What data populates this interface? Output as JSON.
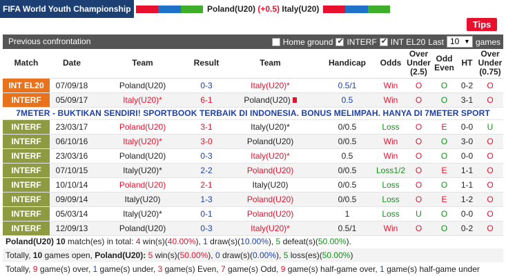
{
  "header": {
    "league": "FIFA World Youth Championship",
    "home": "Poland(U20)",
    "handicap": "(+0.5)",
    "away": "Italy(U20)",
    "home_colors": [
      "#e8112d",
      "#e8112d",
      "#1e73c8",
      "#1e73c8",
      "#3fae2a",
      "#3fae2a"
    ],
    "away_colors": [
      "#e8112d",
      "#e8112d",
      "#1e73c8",
      "#1e73c8",
      "#3fae2a",
      "#3fae2a"
    ]
  },
  "tips_label": "Tips",
  "filter": {
    "title": "Previous confrontation",
    "home_ground": "Home ground",
    "interf": "INTERF",
    "intel": "INT EL20",
    "last_label": "Last",
    "last_value": "10",
    "games_label": "games"
  },
  "columns": [
    "Match",
    "Date",
    "Team",
    "Result",
    "Team",
    "Handicap",
    "Odds",
    "Over Under (2.5)",
    "Odd Even",
    "HT",
    "Over Under (0.75)"
  ],
  "ad_text": "7METER - BUKTIKAN SENDIRI! SPORTBOOK TERBAIK DI INDONESIA. BONUS MELIMPAH. HANYA DI 7METER SPORT",
  "rows": [
    {
      "league": "INT EL20",
      "league_color": "#e8731c",
      "date": "07/09/18",
      "home": "Poland(U20)",
      "home_red": false,
      "home_card": false,
      "result": "0-3",
      "result_color": "blue",
      "away": "Italy(U20)*",
      "away_red": true,
      "handicap": "0.5/1",
      "hcp_color": "blue",
      "odds": "Win",
      "odds_color": "red",
      "ou": "O",
      "ou_color": "red",
      "oe": "O",
      "oe_color": "green",
      "ht": "0-2",
      "ou2": "O",
      "ou2_color": "red"
    },
    {
      "league": "INTERF",
      "league_color": "#e8731c",
      "date": "05/09/17",
      "home": "Italy(U20)*",
      "home_red": true,
      "home_card": false,
      "result": "6-1",
      "result_color": "red",
      "away": "Poland(U20)",
      "away_red": false,
      "away_card": true,
      "handicap": "0.5",
      "hcp_color": "blue",
      "odds": "Win",
      "odds_color": "red",
      "ou": "O",
      "ou_color": "red",
      "oe": "O",
      "oe_color": "green",
      "ht": "3-1",
      "ou2": "O",
      "ou2_color": "red"
    },
    {
      "league": "INTERF",
      "league_color": "#8f9b41",
      "date": "23/03/17",
      "home": "Poland(U20)",
      "home_red": true,
      "home_card": false,
      "result": "3-1",
      "result_color": "red",
      "away": "Italy(U20)*",
      "away_red": false,
      "handicap": "0/0.5",
      "hcp_color": "",
      "odds": "Loss",
      "odds_color": "green",
      "ou": "O",
      "ou_color": "red",
      "oe": "E",
      "oe_color": "red",
      "ht": "0-0",
      "ou2": "U",
      "ou2_color": "green"
    },
    {
      "league": "INTERF",
      "league_color": "#8f9b41",
      "date": "06/10/16",
      "home": "Italy(U20)*",
      "home_red": true,
      "home_card": false,
      "result": "3-0",
      "result_color": "red",
      "away": "Poland(U20)",
      "away_red": false,
      "handicap": "0/0.5",
      "hcp_color": "",
      "odds": "Win",
      "odds_color": "red",
      "ou": "O",
      "ou_color": "red",
      "oe": "O",
      "oe_color": "green",
      "ht": "3-0",
      "ou2": "O",
      "ou2_color": "red"
    },
    {
      "league": "INTERF",
      "league_color": "#8f9b41",
      "date": "23/03/16",
      "home": "Poland(U20)",
      "home_red": false,
      "home_card": false,
      "result": "0-3",
      "result_color": "blue",
      "away": "Italy(U20)*",
      "away_red": true,
      "handicap": "0.5",
      "hcp_color": "",
      "odds": "Win",
      "odds_color": "red",
      "ou": "O",
      "ou_color": "red",
      "oe": "O",
      "oe_color": "green",
      "ht": "0-0",
      "ou2": "O",
      "ou2_color": "red"
    },
    {
      "league": "INTERF",
      "league_color": "#8f9b41",
      "date": "07/10/15",
      "home": "Italy(U20)*",
      "home_red": false,
      "home_card": false,
      "result": "2-2",
      "result_color": "blue",
      "away": "Poland(U20)",
      "away_red": true,
      "handicap": "0/0.5",
      "hcp_color": "",
      "odds": "Loss1/2",
      "odds_color": "green",
      "ou": "O",
      "ou_color": "red",
      "oe": "E",
      "oe_color": "red",
      "ht": "1-1",
      "ou2": "O",
      "ou2_color": "red"
    },
    {
      "league": "INTERF",
      "league_color": "#8f9b41",
      "date": "10/10/14",
      "home": "Poland(U20)",
      "home_red": true,
      "home_card": false,
      "result": "2-1",
      "result_color": "red",
      "away": "Italy(U20)",
      "away_red": false,
      "handicap": "0/0.5",
      "hcp_color": "",
      "odds": "Loss",
      "odds_color": "green",
      "ou": "O",
      "ou_color": "red",
      "oe": "O",
      "oe_color": "green",
      "ht": "1-1",
      "ou2": "O",
      "ou2_color": "red"
    },
    {
      "league": "INTERF",
      "league_color": "#8f9b41",
      "date": "09/09/14",
      "home": "Italy(U20)",
      "home_red": false,
      "home_card": false,
      "result": "1-3",
      "result_color": "blue",
      "away": "Poland(U20)",
      "away_red": true,
      "handicap": "0/0.5",
      "hcp_color": "",
      "odds": "Loss",
      "odds_color": "green",
      "ou": "O",
      "ou_color": "red",
      "oe": "E",
      "oe_color": "red",
      "ht": "1-2",
      "ou2": "O",
      "ou2_color": "red"
    },
    {
      "league": "INTERF",
      "league_color": "#8f9b41",
      "date": "05/03/14",
      "home": "Italy(U20)*",
      "home_red": false,
      "home_card": false,
      "result": "0-1",
      "result_color": "blue",
      "away": "Poland(U20)",
      "away_red": true,
      "handicap": "1",
      "hcp_color": "",
      "odds": "Loss",
      "odds_color": "green",
      "ou": "U",
      "ou_color": "green",
      "oe": "O",
      "oe_color": "green",
      "ht": "0-0",
      "ou2": "O",
      "ou2_color": "red"
    },
    {
      "league": "INTERF",
      "league_color": "#8f9b41",
      "date": "12/09/13",
      "home": "Poland(U20)",
      "home_red": false,
      "home_card": false,
      "result": "0-3",
      "result_color": "blue",
      "away": "Italy(U20)*",
      "away_red": true,
      "handicap": "0.5/1",
      "hcp_color": "",
      "odds": "Win",
      "odds_color": "red",
      "ou": "O",
      "ou_color": "red",
      "oe": "O",
      "oe_color": "green",
      "ht": "0-2",
      "ou2": "O",
      "ou2_color": "red"
    }
  ],
  "summary": {
    "line1": [
      {
        "t": "Poland(U20) ",
        "c": "b"
      },
      {
        "t": "10",
        "c": "b"
      },
      {
        "t": " match(es) in total: ",
        "c": ""
      },
      {
        "t": "4",
        "c": "r"
      },
      {
        "t": " win(s)(",
        "c": ""
      },
      {
        "t": "40.00%",
        "c": "r"
      },
      {
        "t": "), ",
        "c": ""
      },
      {
        "t": "1",
        "c": "bl"
      },
      {
        "t": " draw(s)(",
        "c": ""
      },
      {
        "t": "10.00%",
        "c": "bl"
      },
      {
        "t": "), ",
        "c": ""
      },
      {
        "t": "5",
        "c": "g"
      },
      {
        "t": " defeat(s)(",
        "c": ""
      },
      {
        "t": "50.00%",
        "c": "g"
      },
      {
        "t": ").",
        "c": ""
      }
    ],
    "line2": [
      {
        "t": "Totally, ",
        "c": ""
      },
      {
        "t": "10",
        "c": "b"
      },
      {
        "t": " games open, ",
        "c": ""
      },
      {
        "t": "Poland(U20):",
        "c": "b"
      },
      {
        "t": " ",
        "c": ""
      },
      {
        "t": "5",
        "c": "r"
      },
      {
        "t": " win(s)(",
        "c": ""
      },
      {
        "t": "50.00%",
        "c": "r"
      },
      {
        "t": "), ",
        "c": ""
      },
      {
        "t": "0",
        "c": "bl"
      },
      {
        "t": " draw(s)(",
        "c": ""
      },
      {
        "t": "0.00%",
        "c": "bl"
      },
      {
        "t": "), ",
        "c": ""
      },
      {
        "t": "5",
        "c": "g"
      },
      {
        "t": " loss(es)(",
        "c": ""
      },
      {
        "t": "50.00%",
        "c": "g"
      },
      {
        "t": ")",
        "c": ""
      }
    ],
    "line3": [
      {
        "t": "Totally, ",
        "c": ""
      },
      {
        "t": "9",
        "c": "r"
      },
      {
        "t": " game(s) over, ",
        "c": ""
      },
      {
        "t": "1",
        "c": "bl"
      },
      {
        "t": " game(s) under, ",
        "c": ""
      },
      {
        "t": "3",
        "c": "r"
      },
      {
        "t": " game(s) Even, ",
        "c": ""
      },
      {
        "t": "7",
        "c": "r"
      },
      {
        "t": " game(s) Odd, ",
        "c": ""
      },
      {
        "t": "9",
        "c": "r"
      },
      {
        "t": " game(s) half-game over, ",
        "c": ""
      },
      {
        "t": "1",
        "c": "bl"
      },
      {
        "t": " game(s) half-game under",
        "c": ""
      }
    ]
  }
}
